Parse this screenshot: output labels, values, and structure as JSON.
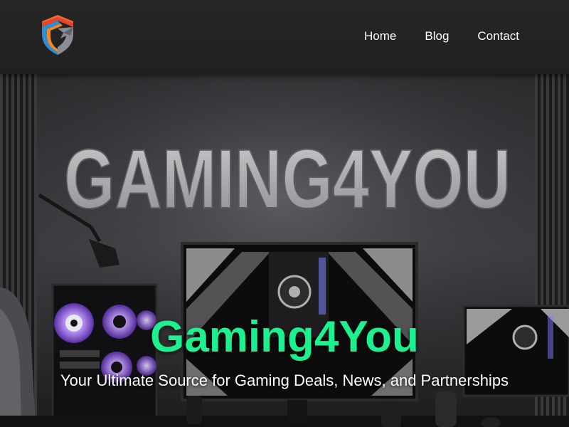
{
  "header": {
    "logo": {
      "icon": "shield-logo-icon"
    },
    "nav": [
      {
        "label": "Home"
      },
      {
        "label": "Blog"
      },
      {
        "label": "Contact"
      }
    ]
  },
  "hero": {
    "background_image": {
      "wall_sign_text": "GAMING4YOU"
    },
    "title": "Gaming4You",
    "subtitle": "Your Ultimate Source for Gaming Deals, News, and Partnerships"
  },
  "colors": {
    "header_bg": "#222222",
    "title_green": "#1df08f",
    "subtitle": "#ffffff",
    "nav_text": "#ffffff",
    "logo_red": "#e8452c",
    "logo_blue": "#2b8fd6",
    "logo_gray": "#8a8e94"
  }
}
